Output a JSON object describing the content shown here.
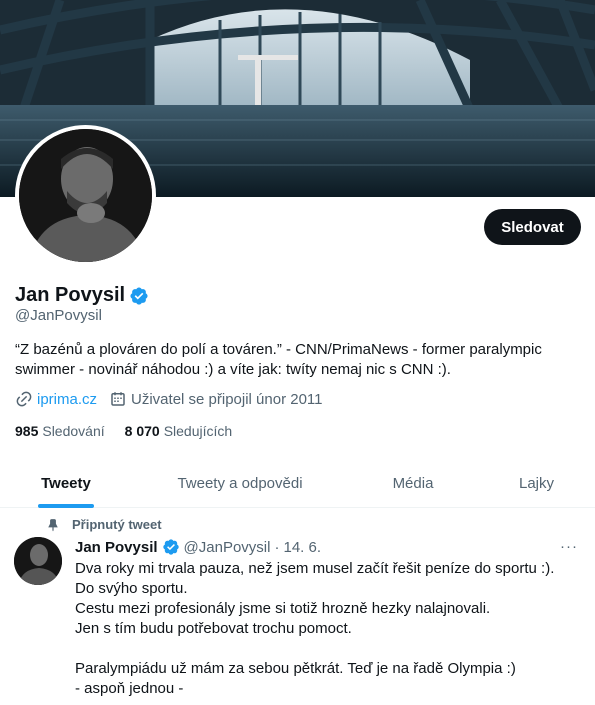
{
  "profile": {
    "name": "Jan Povysil",
    "handle": "@JanPovysil",
    "bio": "“Z bazénů a plováren do polí a továren.” - CNN/PrimaNews - former paralympic swimmer - novinář náhodou :) a víte jak: twíty nemaj nic s CNN :).",
    "website": "iprima.cz",
    "joined": "Uživatel se připojil únor 2011",
    "following_count": "985",
    "following_label": "Sledování",
    "followers_count": "8 070",
    "followers_label": "Sledujících",
    "follow_button": "Sledovat"
  },
  "tabs": [
    {
      "label": "Tweety",
      "active": true
    },
    {
      "label": "Tweety a odpovědi",
      "active": false
    },
    {
      "label": "Média",
      "active": false
    },
    {
      "label": "Lajky",
      "active": false
    }
  ],
  "pinned_tweet": {
    "pinned_label": "Připnutý tweet",
    "author": "Jan Povysil",
    "handle": "@JanPovysil",
    "separator": "·",
    "date": "14. 6.",
    "more": "···",
    "lines": [
      "Dva roky mi trvala pauza, než jsem musel začít řešit peníze do sportu :).",
      "Do svýho sportu.",
      "Cestu mezi profesionály jsme si totiž hrozně hezky nalajnovali.",
      "Jen s tím budu potřebovat trochu pomoct.",
      "",
      "Paralympiádu už mám za sebou pětkrát. Teď je na řadě Olympia :)",
      "- aspoň jednou -"
    ]
  },
  "colors": {
    "accent": "#1d9bf0",
    "text_primary": "#0f1419",
    "text_secondary": "#536471",
    "button_bg": "#0f1419"
  },
  "icons": [
    "verified-badge-icon",
    "link-icon",
    "calendar-icon",
    "pin-icon",
    "more-icon"
  ]
}
